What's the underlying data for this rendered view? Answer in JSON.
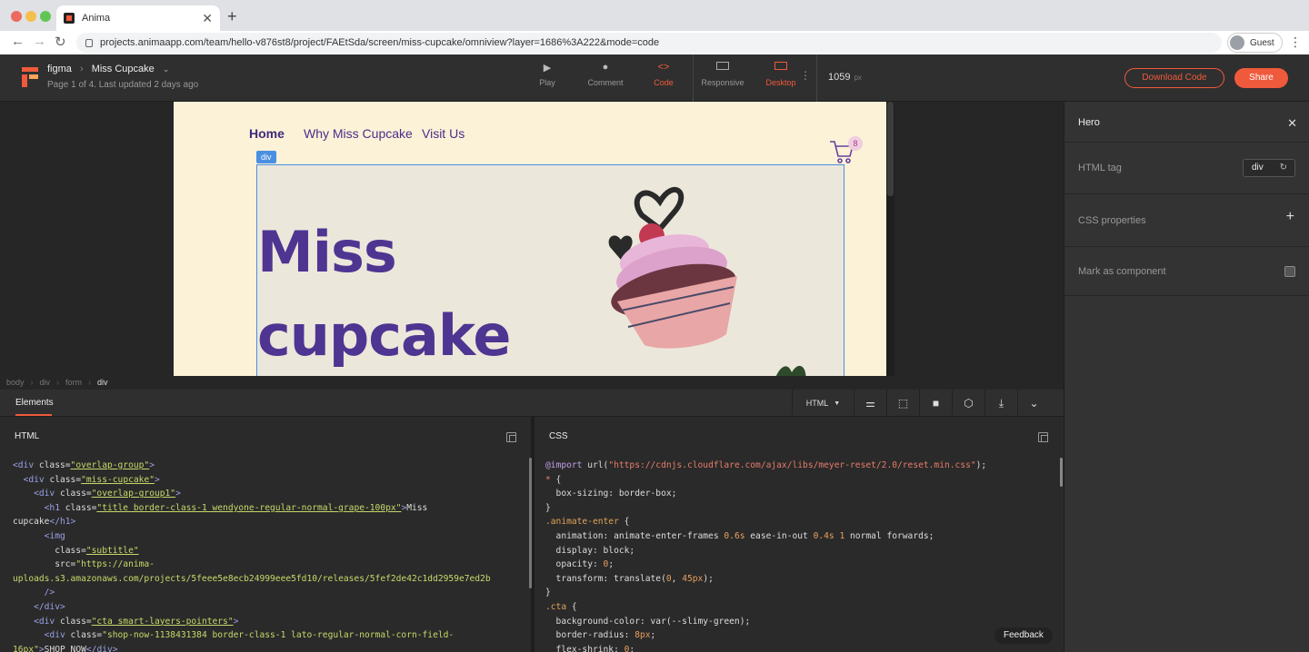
{
  "browser": {
    "tab_title": "Anima",
    "new_tab": "+",
    "url": "projects.animaapp.com/team/hello-v876st8/project/FAEtSda/screen/miss-cupcake/omniview?layer=1686%3A222&mode=code",
    "profile_label": "Guest"
  },
  "header": {
    "source": "figma",
    "screen_name": "Miss Cupcake",
    "meta": "Page 1 of 4. Last updated 2 days ago",
    "modes": [
      {
        "label": "Play",
        "icon": "play-icon"
      },
      {
        "label": "Comment",
        "icon": "comment-icon"
      },
      {
        "label": "Code",
        "icon": "code-icon",
        "active": true
      }
    ],
    "devices": [
      {
        "label": "Responsive",
        "icon": "monitor-icon"
      },
      {
        "label": "Desktop",
        "icon": "desktop-icon",
        "active": true
      }
    ],
    "width_value": "1059",
    "width_unit": "px",
    "download_label": "Download Code",
    "share_label": "Share",
    "accent": "#f05a3c"
  },
  "preview": {
    "nav": [
      "Home",
      "Why Miss Cupcake",
      "Visit Us"
    ],
    "cart_count": "8",
    "selection_tag": "div",
    "hero_title_line1": "Miss",
    "hero_title_line2": "cupcake",
    "colors": {
      "background": "#fcf2d8",
      "title": "#4e3591"
    }
  },
  "inspector": {
    "title": "Hero",
    "html_tag_label": "HTML tag",
    "html_tag_value": "div",
    "css_label": "CSS properties",
    "component_label": "Mark as component"
  },
  "breadcrumb": [
    "body",
    "div",
    "form",
    "div"
  ],
  "bottom": {
    "tab": "Elements",
    "language": "HTML",
    "html_title": "HTML",
    "css_title": "CSS",
    "feedback": "Feedback"
  }
}
